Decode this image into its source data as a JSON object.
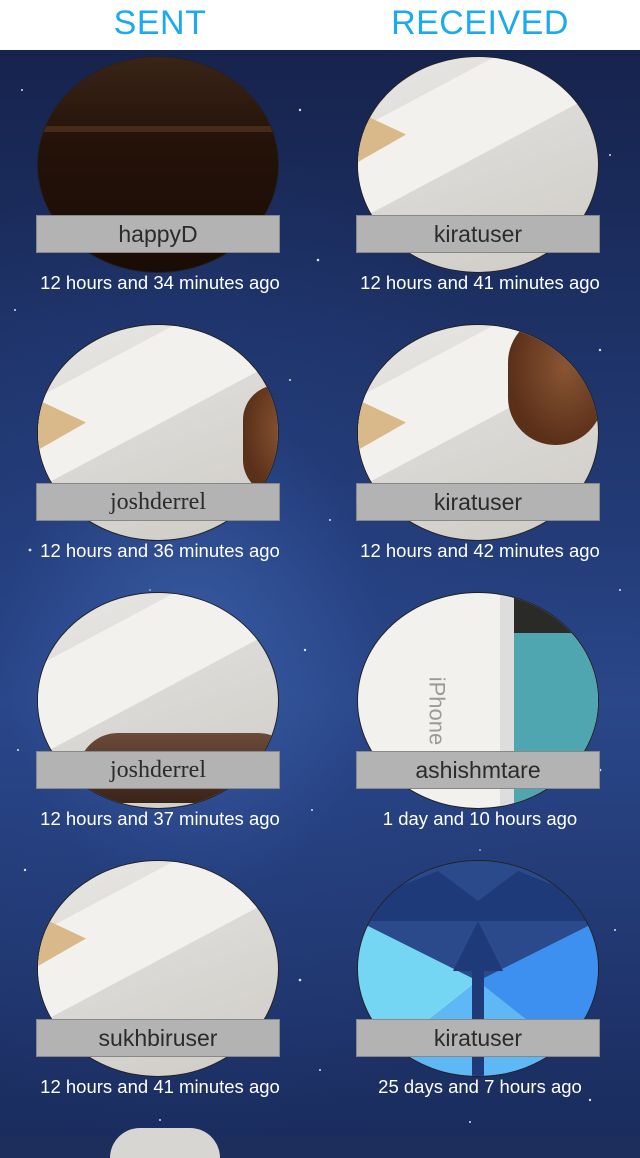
{
  "tabs": {
    "sent": "SENT",
    "received": "RECEIVED"
  },
  "sent": [
    {
      "name": "happyD",
      "time": "12 hours and 34 minutes ago"
    },
    {
      "name": "joshderrel",
      "time": "12 hours and 36 minutes ago"
    },
    {
      "name": "joshderrel",
      "time": "12 hours and 37 minutes ago"
    },
    {
      "name": "sukhbiruser",
      "time": "12 hours and 41 minutes ago"
    }
  ],
  "received": [
    {
      "name": "kiratuser",
      "time": "12 hours and 41 minutes ago"
    },
    {
      "name": "kiratuser",
      "time": "12 hours and 42 minutes ago"
    },
    {
      "name": "ashishmtare",
      "time": "1 day and 10 hours ago"
    },
    {
      "name": "kiratuser",
      "time": "25 days and 7 hours ago"
    }
  ],
  "photo_labels": {
    "iphone": "iPhone"
  },
  "colors": {
    "accent": "#1ba9f0",
    "name_bar": "#b3b3b3",
    "background": "#1d2d5c"
  }
}
